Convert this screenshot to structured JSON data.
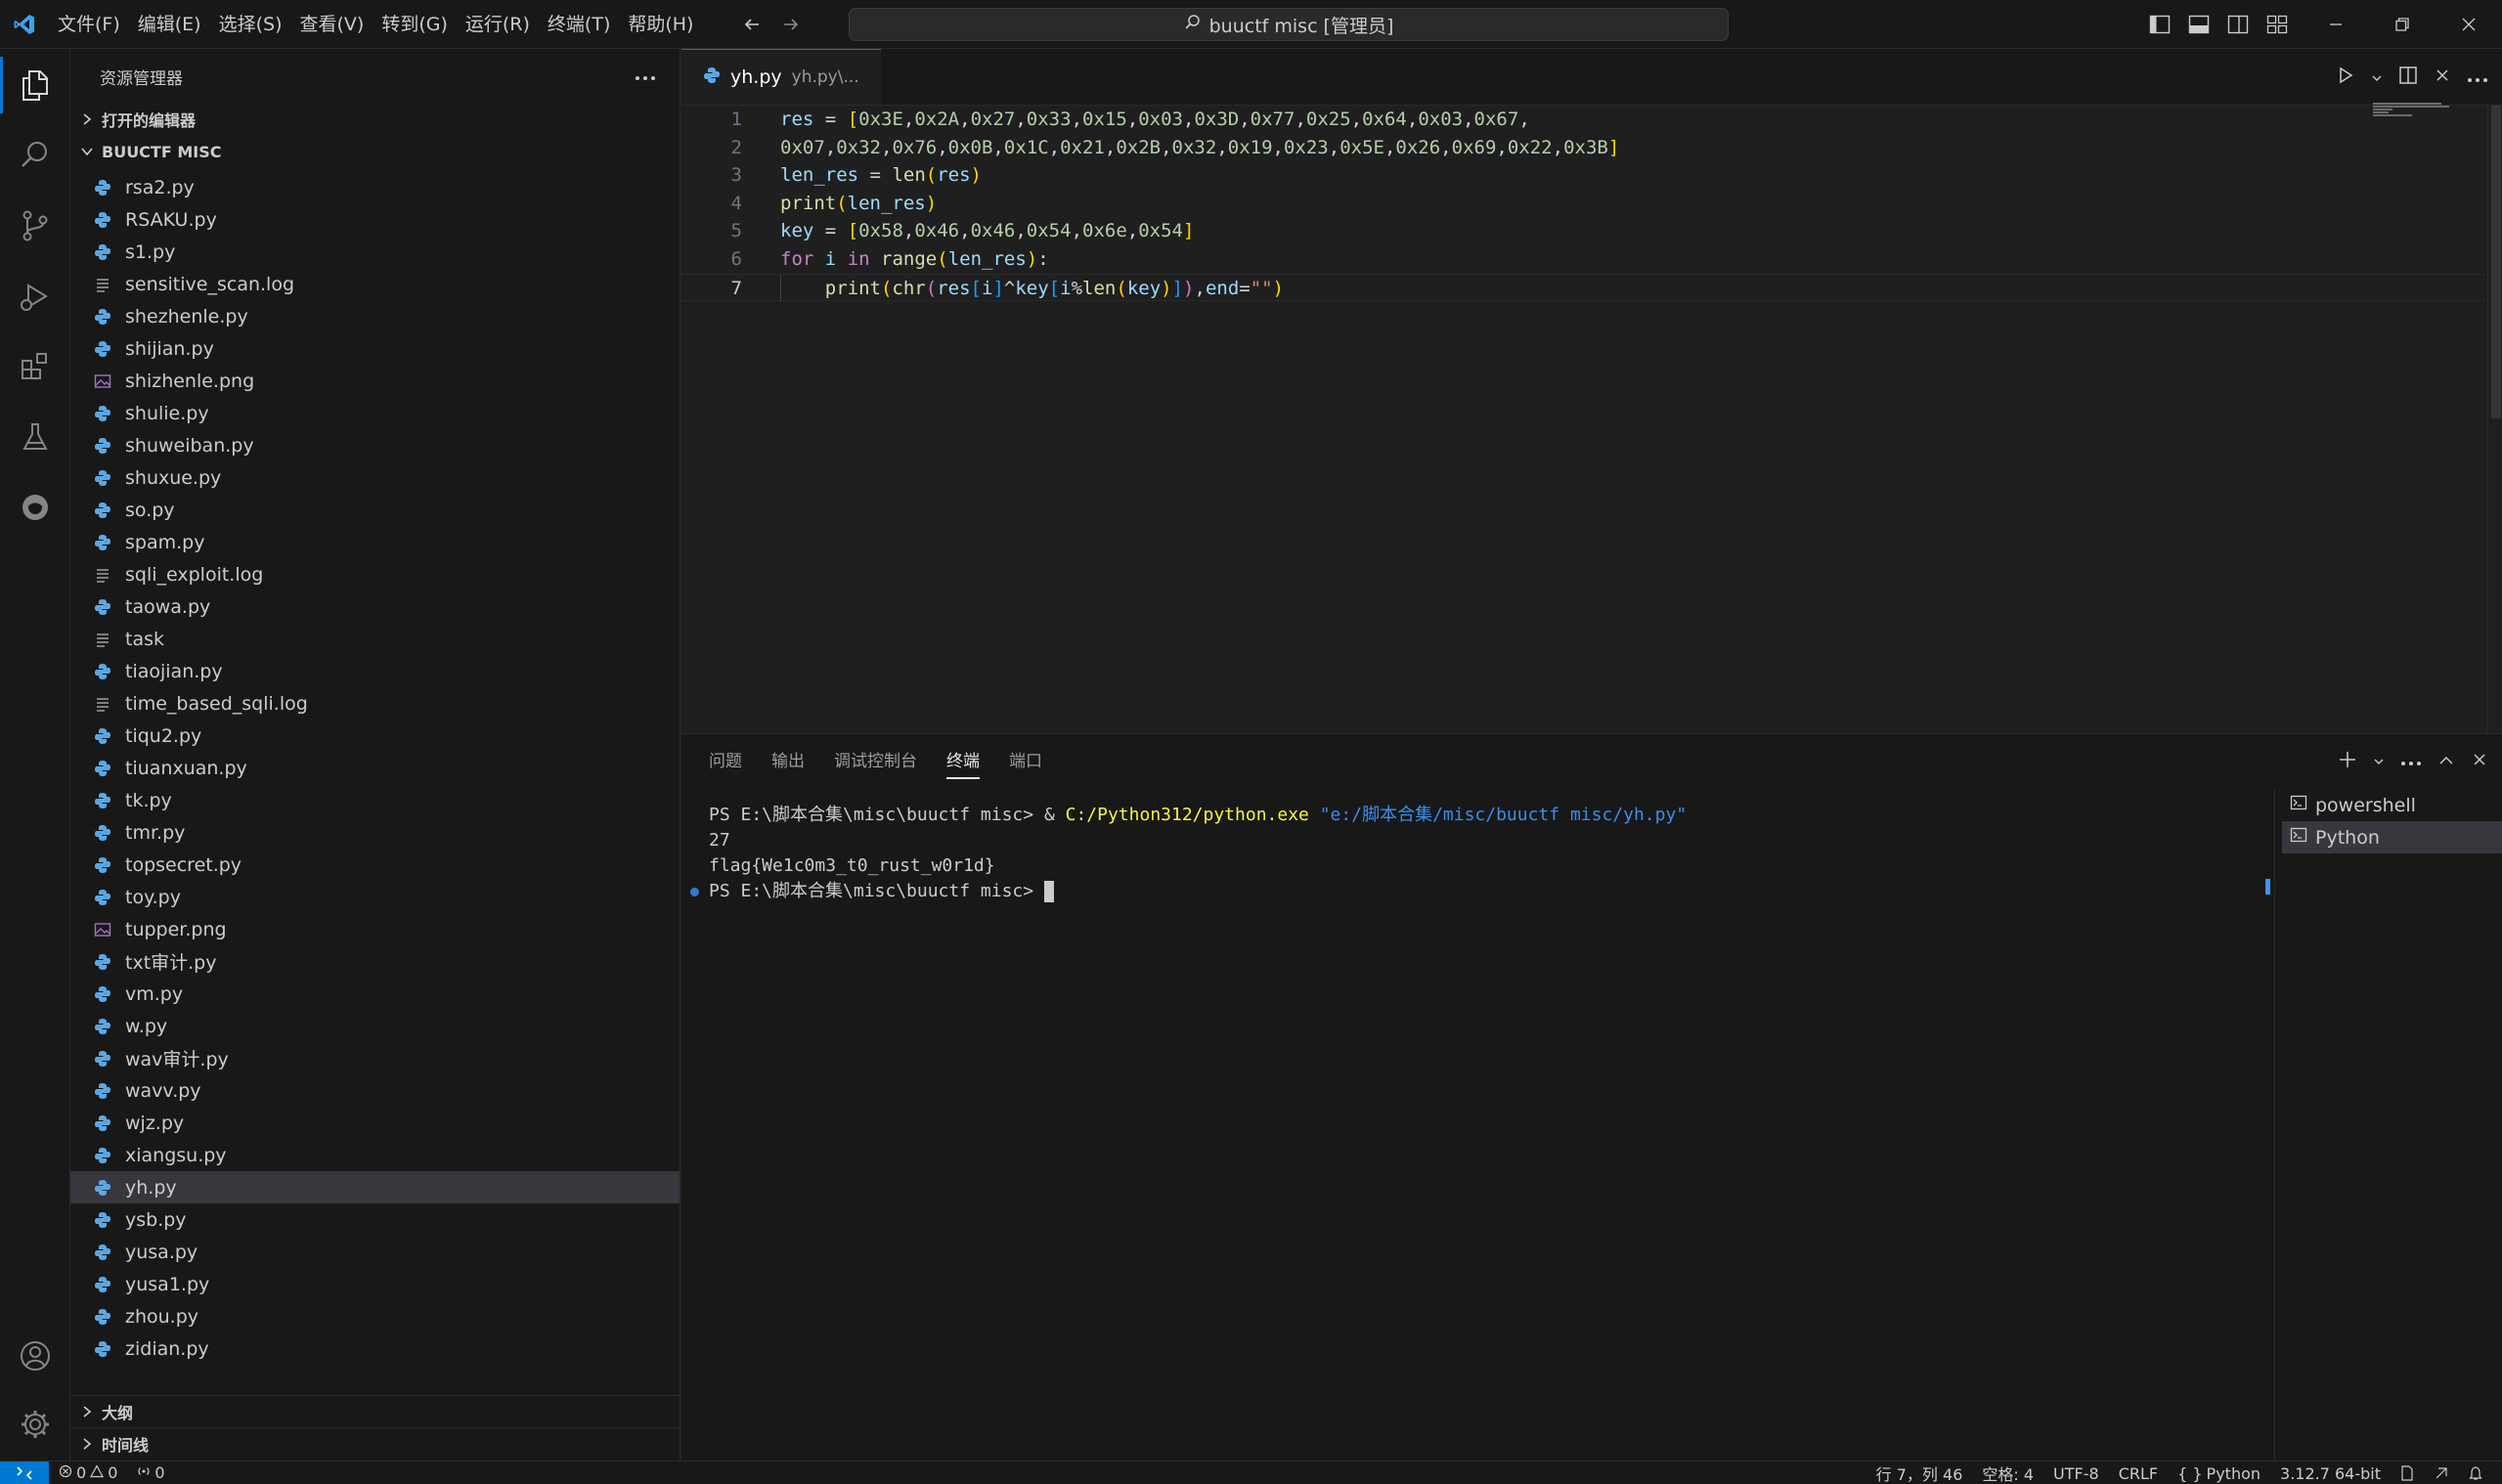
{
  "titlebar": {
    "menu": [
      "文件(F)",
      "编辑(E)",
      "选择(S)",
      "查看(V)",
      "转到(G)",
      "运行(R)",
      "终端(T)",
      "帮助(H)"
    ],
    "search_text": "buuctf misc [管理员]"
  },
  "sidebar": {
    "title": "资源管理器",
    "open_editors": "打开的编辑器",
    "folder": "BUUCTF MISC",
    "files": [
      {
        "name": "rsa2.py",
        "icon": "python-icon"
      },
      {
        "name": "RSAKU.py",
        "icon": "python-icon"
      },
      {
        "name": "s1.py",
        "icon": "python-icon"
      },
      {
        "name": "sensitive_scan.log",
        "icon": "text-file-icon"
      },
      {
        "name": "shezhenle.py",
        "icon": "python-icon"
      },
      {
        "name": "shijian.py",
        "icon": "python-icon"
      },
      {
        "name": "shizhenle.png",
        "icon": "image-icon"
      },
      {
        "name": "shulie.py",
        "icon": "python-icon"
      },
      {
        "name": "shuweiban.py",
        "icon": "python-icon"
      },
      {
        "name": "shuxue.py",
        "icon": "python-icon"
      },
      {
        "name": "so.py",
        "icon": "python-icon"
      },
      {
        "name": "spam.py",
        "icon": "python-icon"
      },
      {
        "name": "sqli_exploit.log",
        "icon": "text-file-icon"
      },
      {
        "name": "taowa.py",
        "icon": "python-icon"
      },
      {
        "name": "task",
        "icon": "text-file-icon"
      },
      {
        "name": "tiaojian.py",
        "icon": "python-icon"
      },
      {
        "name": "time_based_sqli.log",
        "icon": "text-file-icon"
      },
      {
        "name": "tiqu2.py",
        "icon": "python-icon"
      },
      {
        "name": "tiuanxuan.py",
        "icon": "python-icon"
      },
      {
        "name": "tk.py",
        "icon": "python-icon"
      },
      {
        "name": "tmr.py",
        "icon": "python-icon"
      },
      {
        "name": "topsecret.py",
        "icon": "python-icon"
      },
      {
        "name": "toy.py",
        "icon": "python-icon"
      },
      {
        "name": "tupper.png",
        "icon": "image-icon"
      },
      {
        "name": "txt审计.py",
        "icon": "python-icon"
      },
      {
        "name": "vm.py",
        "icon": "python-icon"
      },
      {
        "name": "w.py",
        "icon": "python-icon"
      },
      {
        "name": "wav审计.py",
        "icon": "python-icon"
      },
      {
        "name": "wavv.py",
        "icon": "python-icon"
      },
      {
        "name": "wjz.py",
        "icon": "python-icon"
      },
      {
        "name": "xiangsu.py",
        "icon": "python-icon"
      },
      {
        "name": "yh.py",
        "icon": "python-icon",
        "selected": true
      },
      {
        "name": "ysb.py",
        "icon": "python-icon"
      },
      {
        "name": "yusa.py",
        "icon": "python-icon"
      },
      {
        "name": "yusa1.py",
        "icon": "python-icon"
      },
      {
        "name": "zhou.py",
        "icon": "python-icon"
      },
      {
        "name": "zidian.py",
        "icon": "python-icon"
      }
    ],
    "outline": "大纲",
    "timeline": "时间线"
  },
  "editor": {
    "tab_name": "yh.py",
    "tab_path": "yh.py\\...",
    "line_numbers": [
      "1",
      "2",
      "3",
      "4",
      "5",
      "6",
      "7"
    ],
    "current_line": 7,
    "code": [
      "res = [0x3E,0x2A,0x27,0x33,0x15,0x03,0x3D,0x77,0x25,0x64,0x03,0x67,",
      "0x07,0x32,0x76,0x0B,0x1C,0x21,0x2B,0x32,0x19,0x23,0x5E,0x26,0x69,0x22,0x3B]",
      "len_res = len(res)",
      "print(len_res)",
      "key = [0x58,0x46,0x46,0x54,0x6e,0x54]",
      "for i in range(len_res):",
      "    print(chr(res[i]^key[i%len(key)]),end=\"\")"
    ]
  },
  "panel": {
    "tabs": [
      "问题",
      "输出",
      "调试控制台",
      "终端",
      "端口"
    ],
    "active_tab": "终端",
    "terminal": {
      "prompt": "PS E:\\脚本合集\\misc\\buuctf misc> ",
      "cmd_amp": "& ",
      "cmd_exe": "C:/Python312/python.exe",
      "cmd_arg": "\"e:/脚本合集/misc/buuctf misc/yh.py\"",
      "out1": "27",
      "out2": "flag{We1c0m3_t0_rust_w0r1d}",
      "prompt2": "PS E:\\脚本合集\\misc\\buuctf misc> "
    },
    "terminals": [
      "powershell",
      "Python"
    ],
    "selected_terminal": "Python"
  },
  "statusbar": {
    "errors": "0",
    "warnings": "0",
    "ports": "0",
    "position": "行 7，列 46",
    "spaces": "空格: 4",
    "encoding": "UTF-8",
    "eol": "CRLF",
    "language": "Python",
    "interpreter": "3.12.7 64-bit"
  },
  "colors": {
    "accent": "#0078d4",
    "background": "#1f1f1f",
    "sidebar": "#181818",
    "selection": "#37373d"
  }
}
